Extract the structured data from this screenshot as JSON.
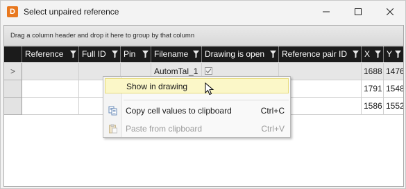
{
  "window": {
    "icon_letter": "D",
    "title": "Select unpaired reference",
    "accent": "#e8781f"
  },
  "group_bar": {
    "hint": "Drag a column header and drop it here to group by that column"
  },
  "grid": {
    "columns": [
      "Reference",
      "Full ID",
      "Pin",
      "Filename",
      "Drawing is open",
      "Reference pair ID",
      "X",
      "Y"
    ],
    "rows": [
      {
        "row_header": ">",
        "reference": "",
        "full_id": "",
        "pin": "",
        "filename": "AutomTal_1",
        "drawing_open": true,
        "pair_id": "",
        "x": "1688",
        "y": "1476"
      },
      {
        "row_header": "",
        "reference": "",
        "full_id": "",
        "pin": "",
        "filename": "",
        "drawing_open": false,
        "pair_id": "",
        "x": "1791",
        "y": "1548"
      },
      {
        "row_header": "",
        "reference": "",
        "full_id": "",
        "pin": "",
        "filename": "",
        "drawing_open": false,
        "pair_id": "",
        "x": "1586",
        "y": "1552"
      }
    ]
  },
  "context_menu": {
    "items": [
      {
        "label": "Show in drawing",
        "shortcut": "",
        "highlighted": true,
        "enabled": true,
        "icon": ""
      },
      {
        "label": "Copy cell values to clipboard",
        "shortcut": "Ctrl+C",
        "highlighted": false,
        "enabled": true,
        "icon": "copy-icon"
      },
      {
        "label": "Paste from clipboard",
        "shortcut": "Ctrl+V",
        "highlighted": false,
        "enabled": false,
        "icon": "paste-icon"
      }
    ]
  }
}
